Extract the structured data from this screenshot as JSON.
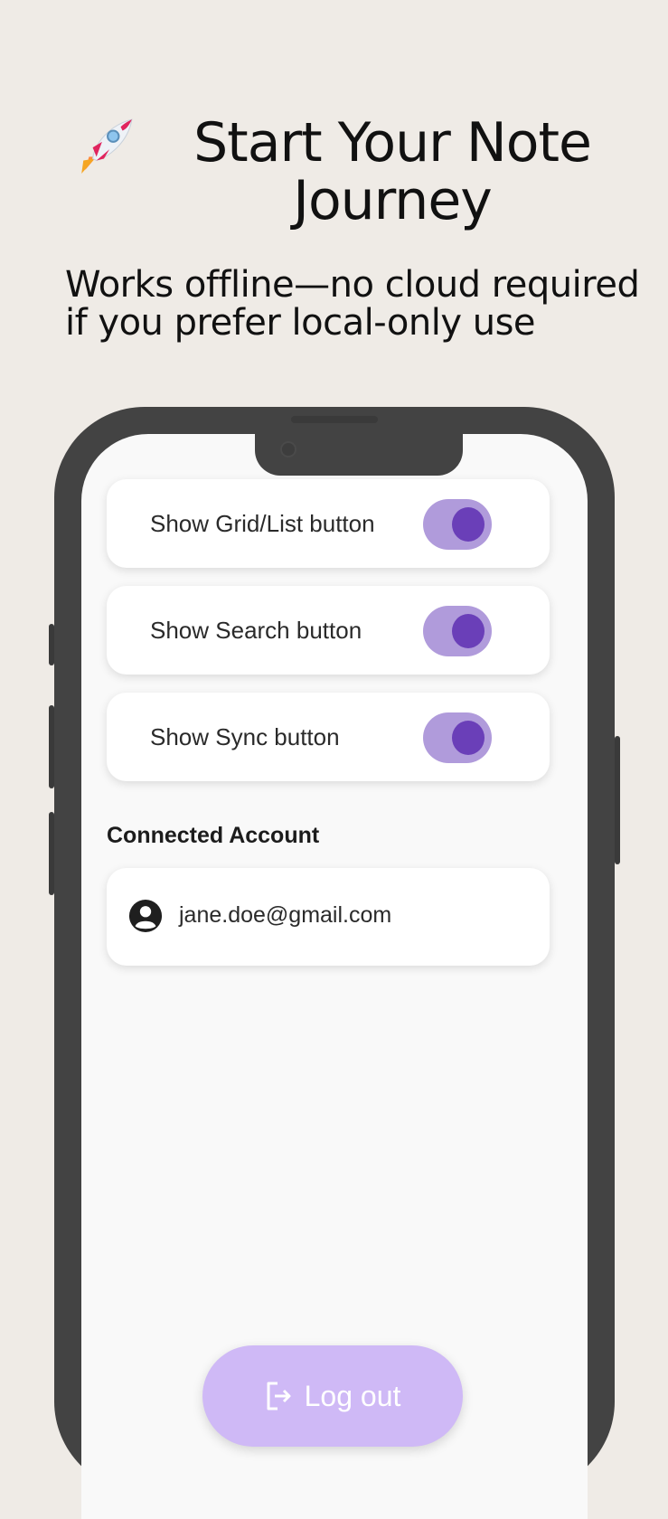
{
  "hero": {
    "title": "Start Your Note Journey",
    "subtitle": "Works offline—no cloud required if you prefer local-only use"
  },
  "settings": {
    "toggles": [
      {
        "label": "Show Grid/List button",
        "on": true
      },
      {
        "label": "Show Search button",
        "on": true
      },
      {
        "label": "Show Sync button",
        "on": true
      }
    ]
  },
  "account": {
    "section_title": "Connected Account",
    "email": "jane.doe@gmail.com"
  },
  "actions": {
    "logout_label": "Log out"
  },
  "colors": {
    "toggle_track": "#b09bdb",
    "toggle_knob": "#6a3fb8",
    "logout_bg": "#cfb9f6",
    "background": "#efebe6",
    "phone_frame": "#434343"
  },
  "icons": [
    "rocket-icon",
    "account-circle-icon",
    "logout-icon"
  ]
}
